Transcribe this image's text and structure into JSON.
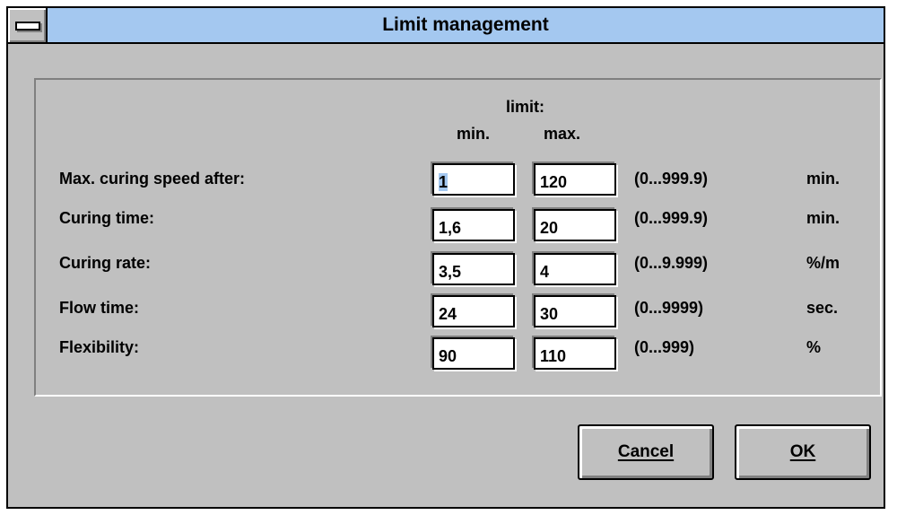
{
  "window": {
    "title": "Limit management"
  },
  "header": {
    "limit": "limit:",
    "min": "min.",
    "max": "max."
  },
  "rows": [
    {
      "label": "Max. curing speed after:",
      "min": "1",
      "max": "120",
      "range": "(0...999.9)",
      "unit": "min."
    },
    {
      "label": "Curing time:",
      "min": "1,6",
      "max": "20",
      "range": "(0...999.9)",
      "unit": "min."
    },
    {
      "label": "Curing rate:",
      "min": "3,5",
      "max": "4",
      "range": "(0...9.999)",
      "unit": "%/m"
    },
    {
      "label": "Flow time:",
      "min": "24",
      "max": "30",
      "range": "(0...9999)",
      "unit": "sec."
    },
    {
      "label": "Flexibility:",
      "min": "90",
      "max": "110",
      "range": "(0...999)",
      "unit": "%"
    }
  ],
  "buttons": {
    "cancel": "Cancel",
    "ok": "OK"
  },
  "colors": {
    "face": "#c0c0c0",
    "titlebar": "#a4c8f0",
    "selection": "#a4c8f0"
  }
}
